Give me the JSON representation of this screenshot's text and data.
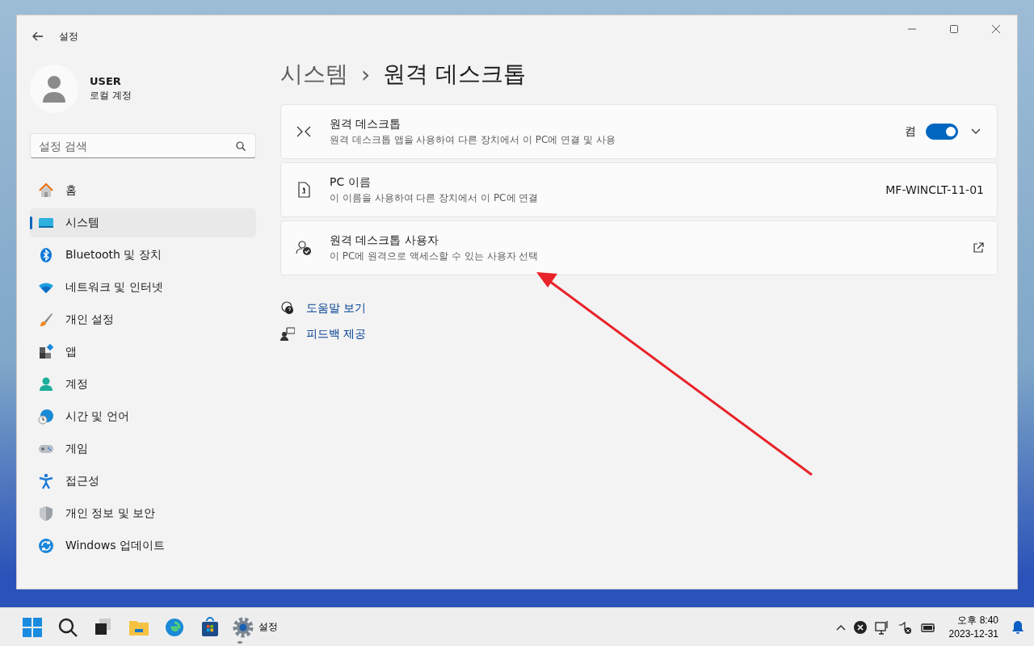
{
  "window": {
    "title": "설정"
  },
  "account": {
    "name": "USER",
    "type": "로컬 계정"
  },
  "search": {
    "placeholder": "설정 검색"
  },
  "nav": [
    {
      "label": "홈",
      "selected": false
    },
    {
      "label": "시스템",
      "selected": true
    },
    {
      "label": "Bluetooth 및 장치",
      "selected": false
    },
    {
      "label": "네트워크 및 인터넷",
      "selected": false
    },
    {
      "label": "개인 설정",
      "selected": false
    },
    {
      "label": "앱",
      "selected": false
    },
    {
      "label": "계정",
      "selected": false
    },
    {
      "label": "시간 및 언어",
      "selected": false
    },
    {
      "label": "게임",
      "selected": false
    },
    {
      "label": "접근성",
      "selected": false
    },
    {
      "label": "개인 정보 및 보안",
      "selected": false
    },
    {
      "label": "Windows 업데이트",
      "selected": false
    }
  ],
  "breadcrumb": {
    "parent": "시스템",
    "separator": "›",
    "current": "원격 데스크톱"
  },
  "settings": [
    {
      "kind": "toggle",
      "title": "원격 데스크톱",
      "description": "원격 데스크톱 앱을 사용하여 다른 장치에서 이 PC에 연결 및 사용",
      "state_label": "켬",
      "on": true
    },
    {
      "kind": "value",
      "title": "PC 이름",
      "description": "이 이름을 사용하여 다른 장치에서 이 PC에 연결",
      "value": "MF-WINCLT-11-01"
    },
    {
      "kind": "link",
      "title": "원격 데스크톱 사용자",
      "description": "이 PC에 원격으로 액세스할 수 있는 사용자 선택"
    }
  ],
  "links": [
    {
      "kind": "help",
      "label": "도움말 보기"
    },
    {
      "kind": "feedback",
      "label": "피드백 제공"
    }
  ],
  "taskbar": {
    "running_app": "설정"
  },
  "tray": {
    "time": "오후 8:40",
    "date": "2023-12-31"
  }
}
